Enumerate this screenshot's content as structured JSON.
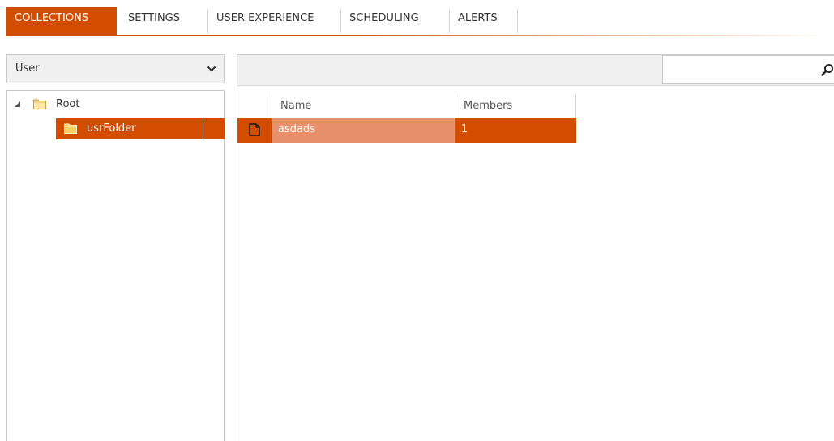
{
  "tabs": [
    {
      "label": "COLLECTIONS",
      "active": true
    },
    {
      "label": "SETTINGS",
      "active": false
    },
    {
      "label": "USER EXPERIENCE",
      "active": false
    },
    {
      "label": "SCHEDULING",
      "active": false
    },
    {
      "label": "ALERTS",
      "active": false
    }
  ],
  "colors": {
    "accent": "#d24d00",
    "row_name_highlight": "#e8906c",
    "panel_bg": "#f0f0f0",
    "border": "#c9c9c9",
    "folder_yellow": "#f3d35f"
  },
  "type_selector": {
    "value": "User",
    "icon": "chevron-down-icon"
  },
  "tree": {
    "nodes": [
      {
        "label": "Root",
        "icon": "folder-icon",
        "expanded": true,
        "selected": false
      },
      {
        "label": "usrFolder",
        "icon": "folder-icon",
        "expanded": false,
        "selected": true
      }
    ]
  },
  "search": {
    "value": "",
    "placeholder": "",
    "icon": "search-icon"
  },
  "grid": {
    "columns": [
      "",
      "Name",
      "Members"
    ],
    "rows": [
      {
        "icon": "document-icon",
        "name": "asdads",
        "members": "1",
        "selected": true
      }
    ]
  }
}
